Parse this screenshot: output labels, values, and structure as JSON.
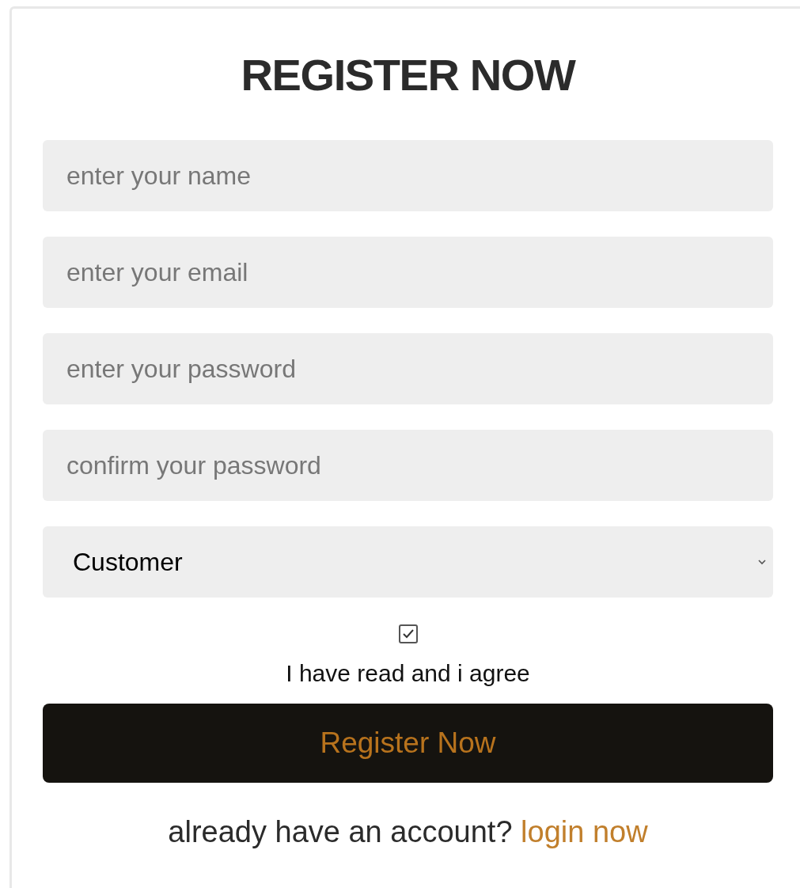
{
  "title": "REGISTER NOW",
  "fields": [
    {
      "placeholder": "enter your name"
    },
    {
      "placeholder": "enter your email"
    },
    {
      "placeholder": "enter your password"
    },
    {
      "placeholder": "confirm your password"
    }
  ],
  "role_select": {
    "value": "Customer"
  },
  "agree": {
    "checked": true,
    "label": "I have read and i agree"
  },
  "submit_button": "Register Now",
  "footer": {
    "text": "already have an account?",
    "link": "login now"
  }
}
